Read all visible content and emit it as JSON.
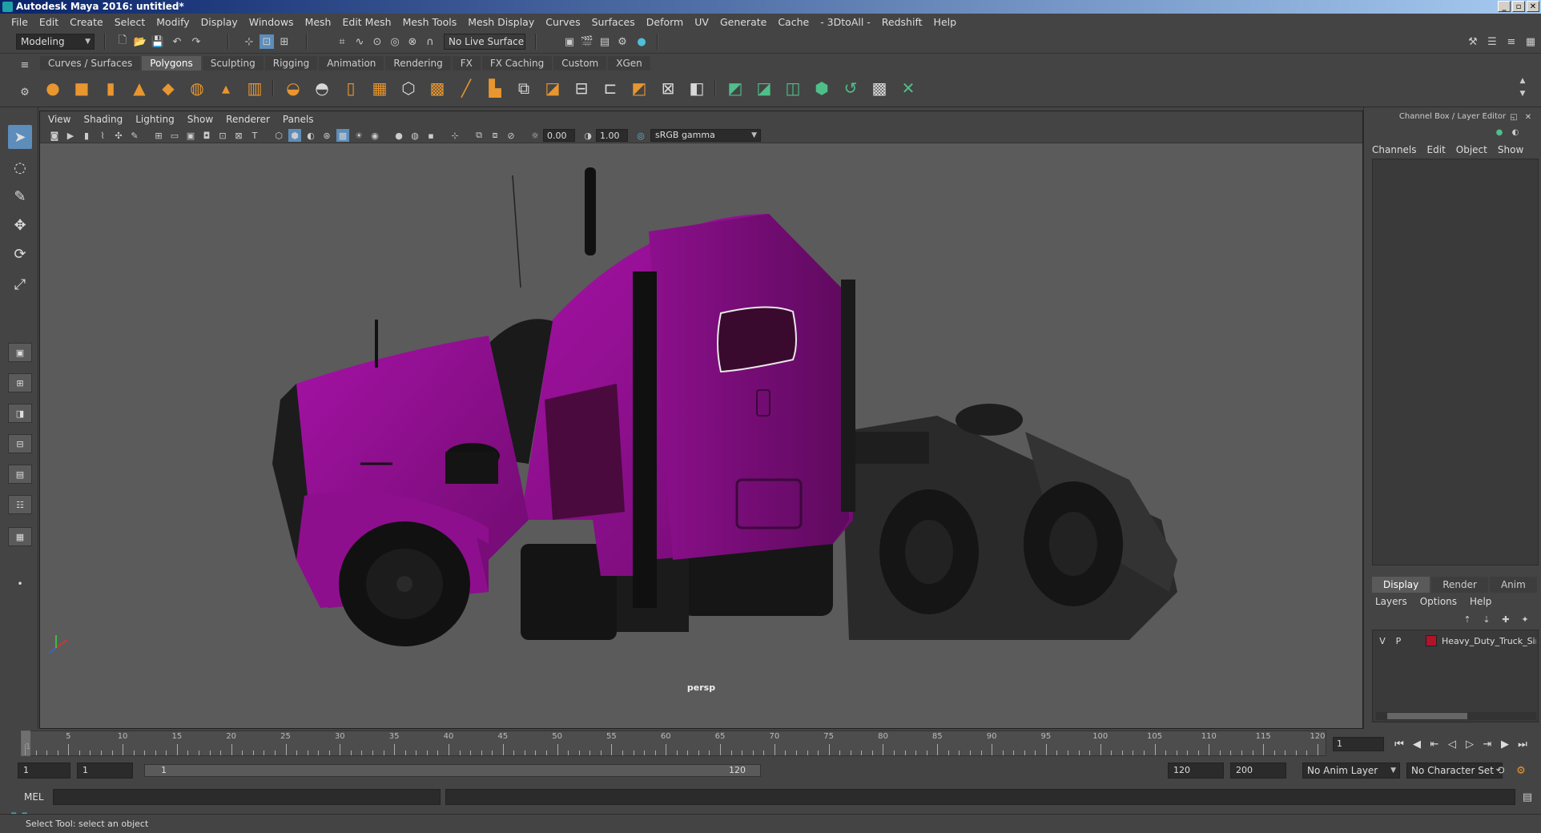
{
  "window": {
    "title": "Autodesk Maya 2016: untitled*"
  },
  "menubar": [
    "File",
    "Edit",
    "Create",
    "Select",
    "Modify",
    "Display",
    "Windows",
    "Mesh",
    "Edit Mesh",
    "Mesh Tools",
    "Mesh Display",
    "Curves",
    "Surfaces",
    "Deform",
    "UV",
    "Generate",
    "Cache",
    "- 3DtoAll -",
    "Redshift",
    "Help"
  ],
  "statusline": {
    "mode": "Modeling",
    "live_surface": "No Live Surface"
  },
  "shelf": {
    "tabs": [
      "Curves / Surfaces",
      "Polygons",
      "Sculpting",
      "Rigging",
      "Animation",
      "Rendering",
      "FX",
      "FX Caching",
      "Custom",
      "XGen"
    ],
    "active_tab": "Polygons"
  },
  "viewport": {
    "menu": [
      "View",
      "Shading",
      "Lighting",
      "Show",
      "Renderer",
      "Panels"
    ],
    "exposure": "0.00",
    "gamma": "1.00",
    "color_space": "sRGB gamma",
    "camera": "persp"
  },
  "channelbox": {
    "title": "Channel Box / Layer Editor",
    "menu": [
      "Channels",
      "Edit",
      "Object",
      "Show"
    ],
    "layer_tabs": [
      "Display",
      "Render",
      "Anim"
    ],
    "active_layer_tab": "Display",
    "layer_menu": [
      "Layers",
      "Options",
      "Help"
    ],
    "layer": {
      "visible": "V",
      "playback": "P",
      "name": "Heavy_Duty_Truck_Sim",
      "color": "#b0132a"
    }
  },
  "timeline": {
    "ticks": [
      "1",
      "5",
      "10",
      "15",
      "20",
      "25",
      "30",
      "35",
      "40",
      "45",
      "50",
      "55",
      "60",
      "65",
      "70",
      "75",
      "80",
      "85",
      "90",
      "95",
      "100",
      "105",
      "110",
      "115",
      "120"
    ],
    "current_frame": "1"
  },
  "range": {
    "start": "1",
    "playback_start": "1",
    "range_start_label": "1",
    "range_end_label": "120",
    "playback_end": "120",
    "end": "200",
    "anim_layer": "No Anim Layer",
    "character_set": "No Character Set"
  },
  "cmdline": {
    "label": "MEL"
  },
  "helpline": {
    "text": "Select Tool: select an object"
  },
  "colors": {
    "truck_body": "#8a0f8a",
    "selection": "#5d8dba"
  }
}
